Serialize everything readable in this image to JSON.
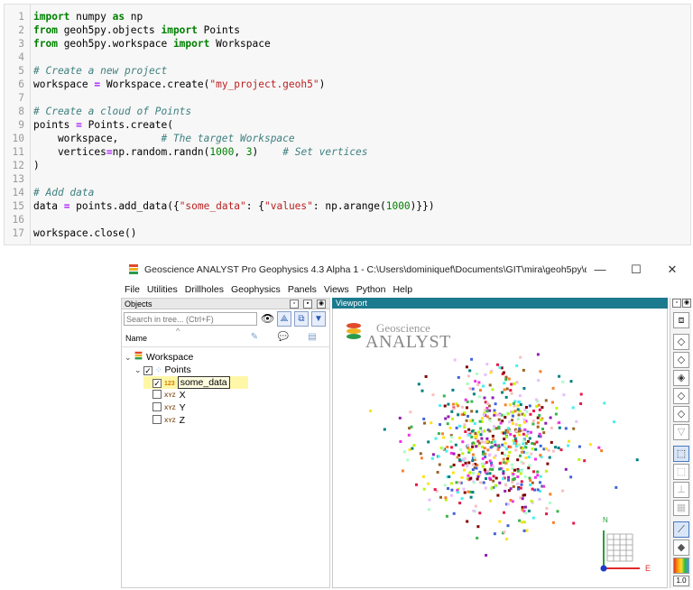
{
  "code": {
    "lines": [
      {
        "n": "1"
      },
      {
        "n": "2"
      },
      {
        "n": "3"
      },
      {
        "n": "4"
      },
      {
        "n": "5"
      },
      {
        "n": "6"
      },
      {
        "n": "7"
      },
      {
        "n": "8"
      },
      {
        "n": "9"
      },
      {
        "n": "10"
      },
      {
        "n": "11"
      },
      {
        "n": "12"
      },
      {
        "n": "13"
      },
      {
        "n": "14"
      },
      {
        "n": "15"
      },
      {
        "n": "16"
      },
      {
        "n": "17"
      }
    ],
    "t": {
      "import": "import",
      "numpy": " numpy ",
      "as": "as",
      "np": " np",
      "from": "from",
      "objects_mod": " geoh5py.objects ",
      "points_cls": " Points",
      "workspace_mod": " geoh5py.workspace ",
      "workspace_cls": " Workspace",
      "c_create_project": "# Create a new project",
      "ws_assign": "workspace ",
      "eq": "=",
      "ws_create": " Workspace.create(",
      "proj_str": "\"my_project.geoh5\"",
      "close_paren": ")",
      "c_create_cloud": "# Create a cloud of Points",
      "points_assign": "points ",
      "points_create": " Points.create(",
      "arg_ws": "    workspace,       ",
      "c_target": "# The target Workspace",
      "arg_vert": "    vertices",
      "vert_call": "np.random.randn(",
      "n1000": "1000",
      "comma": ", ",
      "n3": "3",
      "paren_pad": ")    ",
      "c_set_vert": "# Set vertices",
      "end_paren": ")",
      "c_add_data": "# Add data",
      "data_assign": "data ",
      "add_data": " points.add_data({",
      "some_data_str": "\"some_data\"",
      "colon": ": {",
      "values_str": "\"values\"",
      "colon2": ": np.arange(",
      "n1000b": "1000",
      "closing": ")}})",
      "ws_close": "workspace.close()"
    }
  },
  "window": {
    "title": "Geoscience ANALYST Pro Geophysics 4.3 Alpha 1 - C:\\Users\\dominiquef\\Documents\\GIT\\mira\\geoh5py\\docs\\c...",
    "minimize": "—",
    "maximize": "☐",
    "close": "✕"
  },
  "menu": [
    "File",
    "Utilities",
    "Drillholes",
    "Geophysics",
    "Panels",
    "Views",
    "Python",
    "Help"
  ],
  "objects_panel": {
    "title": "Objects",
    "search_placeholder": "Search in tree... (Ctrl+F)",
    "name_column": "Name",
    "tree": {
      "workspace": "Workspace",
      "points": "Points",
      "some_data": "some_data",
      "some_data_badge": "123",
      "x": "X",
      "y": "Y",
      "z": "Z",
      "xyz_badge": "XYZ"
    }
  },
  "viewport": {
    "title": "Viewport",
    "logo_top": "Geoscience",
    "logo_bottom": "ANALYST",
    "axis_n": "N",
    "axis_e": "E"
  },
  "toolbar": {
    "scale_value": "1.0"
  },
  "colors": {
    "viewport_header": "#1c7a8e",
    "selection": "#fff7a8",
    "point_palette": [
      "#e6194b",
      "#3cb44b",
      "#ffe119",
      "#4363d8",
      "#f58231",
      "#911eb4",
      "#46f0f0",
      "#f032e6",
      "#bcf60c",
      "#fabebe",
      "#008080",
      "#e6beff",
      "#9a6324",
      "#800000",
      "#aaffc3"
    ]
  }
}
